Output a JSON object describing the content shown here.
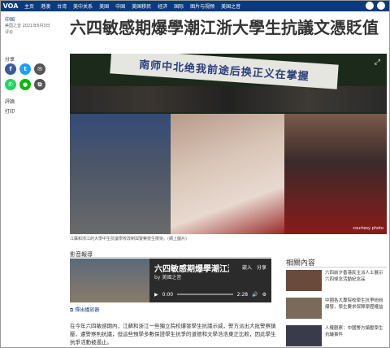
{
  "header": {
    "logo": "VOA",
    "nav": [
      "主页",
      "港澳",
      "台湾",
      "美中关系",
      "美国",
      "中国",
      "美国移民",
      "经济",
      "国际",
      "图片与视频",
      "美国之音"
    ],
    "colors": {
      "bar": "#0b3a7e"
    }
  },
  "article": {
    "category": "中国",
    "meta": "美国之音 2021年6月3日",
    "meta2": "评论",
    "title": "六四敏感期爆學潮江浙大學生抗議文憑貶值"
  },
  "share": {
    "label": "分享",
    "icons": [
      "facebook-icon",
      "twitter-icon",
      "email-icon",
      "whatsapp-icon",
      "line-icon",
      "copy-icon"
    ],
    "comments": "評論",
    "print": "打印"
  },
  "photo": {
    "banner_text": "南师中北绝我前途后换正义在掌握",
    "courtesy": "courtesy photo",
    "caption": "江蘇和浙江的大學中生抗議學校改制與警察發生衝突。(網上圖片)"
  },
  "multimedia": {
    "label": "影音報導",
    "player_title": "六四敏感期爆學潮江浙",
    "author": "by 美國之音",
    "embed": "嵌入",
    "share": "分享",
    "time_current": "0:00",
    "time_total": "2:28",
    "popout": "彈出播放器"
  },
  "body_text": "在今年六四敏感期內，江蘇和浙江一些獨立院校爆發學生抗議示威，警方派出大批警察鎮壓，遭警察則抗議，但這些預學多數保證學生抗爭的道德和文學浩浩東正比較，因此學生抗爭活動被遏止。",
  "related": {
    "title": "相關內容",
    "items": [
      {
        "text": "六四前夕香港民主派人士展示六四悼念活動紀念品",
        "thumb_color": "#6a4a3a"
      },
      {
        "text": "中國各大專院校學生抗爭紛紛爆發，學生要求保障學歷權益",
        "thumb_color": "#7a6a5a"
      },
      {
        "text": "人權觀察：中國警方鎮壓學生抗議事件",
        "thumb_color": "#3a3a4a"
      }
    ]
  }
}
